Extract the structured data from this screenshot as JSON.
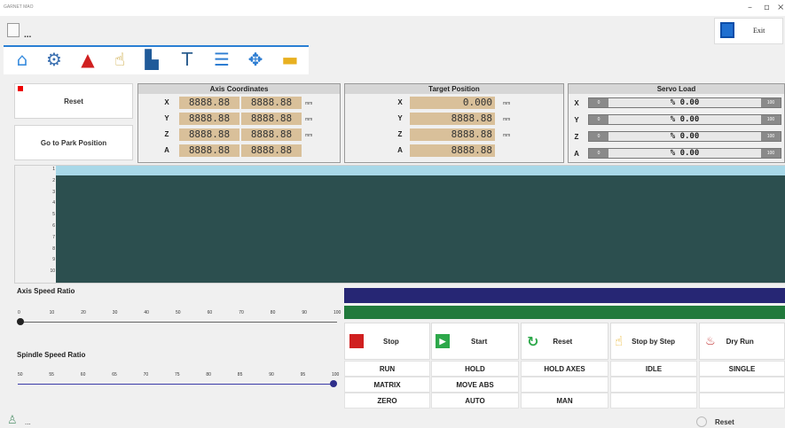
{
  "window": {
    "title": "GARNET MAO"
  },
  "header": {
    "file_label": "...",
    "exit_label": "Exit"
  },
  "toolbar_icons": [
    "home-icon",
    "settings-icon",
    "alarm-icon",
    "hand-icon",
    "machine-icon",
    "spindle-icon",
    "list-icon",
    "jog-icon",
    "folder-icon"
  ],
  "left_buttons": {
    "reset_label": "Reset",
    "park_label": "Go to Park Position"
  },
  "axis_coordinates": {
    "title": "Axis Coordinates",
    "rows": [
      {
        "axis": "X",
        "v1": "8888.88",
        "v2": "8888.88",
        "unit": "mm"
      },
      {
        "axis": "Y",
        "v1": "8888.88",
        "v2": "8888.88",
        "unit": "mm"
      },
      {
        "axis": "Z",
        "v1": "8888.88",
        "v2": "8888.88",
        "unit": "mm"
      },
      {
        "axis": "A",
        "v1": "8888.88",
        "v2": "8888.88",
        "unit": ""
      }
    ]
  },
  "target_position": {
    "title": "Target Position",
    "rows": [
      {
        "axis": "X",
        "v": "0.000",
        "unit": "mm"
      },
      {
        "axis": "Y",
        "v": "8888.88",
        "unit": "mm"
      },
      {
        "axis": "Z",
        "v": "8888.88",
        "unit": "mm"
      },
      {
        "axis": "A",
        "v": "8888.88",
        "unit": ""
      }
    ]
  },
  "servo_load": {
    "title": "Servo Load",
    "rows": [
      {
        "axis": "X",
        "min": "0",
        "value": "% 0.00",
        "max": "100"
      },
      {
        "axis": "Y",
        "min": "0",
        "value": "% 0.00",
        "max": "100"
      },
      {
        "axis": "Z",
        "min": "0",
        "value": "% 0.00",
        "max": "100"
      },
      {
        "axis": "A",
        "min": "0",
        "value": "% 0.00",
        "max": "100"
      }
    ]
  },
  "program_lines": [
    "1",
    "2",
    "3",
    "4",
    "5",
    "6",
    "7",
    "8",
    "9",
    "10"
  ],
  "axis_speed": {
    "label": "Axis Speed Ratio",
    "ticks": [
      "0",
      "10",
      "20",
      "30",
      "40",
      "50",
      "60",
      "70",
      "80",
      "90",
      "100"
    ],
    "value": 0
  },
  "spindle_speed": {
    "label": "Spindle Speed Ratio",
    "ticks": [
      "50",
      "55",
      "60",
      "65",
      "70",
      "75",
      "80",
      "85",
      "90",
      "95",
      "100"
    ],
    "value": 100
  },
  "actions": {
    "stop": "Stop",
    "start": "Start",
    "reset": "Reset",
    "step": "Stop by Step",
    "dry": "Dry Run"
  },
  "status_grid": [
    [
      "RUN",
      "HOLD",
      "HOLD AXES",
      "IDLE",
      "SINGLE"
    ],
    [
      "MATRIX",
      "MOVE ABS",
      "",
      "",
      ""
    ],
    [
      "ZERO",
      "AUTO",
      "MAN",
      "",
      ""
    ]
  ],
  "status_bar": {
    "left_text": "...",
    "reset_label": "Reset"
  },
  "colors": {
    "accent": "#2a7fd4",
    "editor_bg": "#2c4f4f",
    "lcd": "#d9c09a",
    "navy_bar": "#262674",
    "green_bar": "#217a3c"
  }
}
